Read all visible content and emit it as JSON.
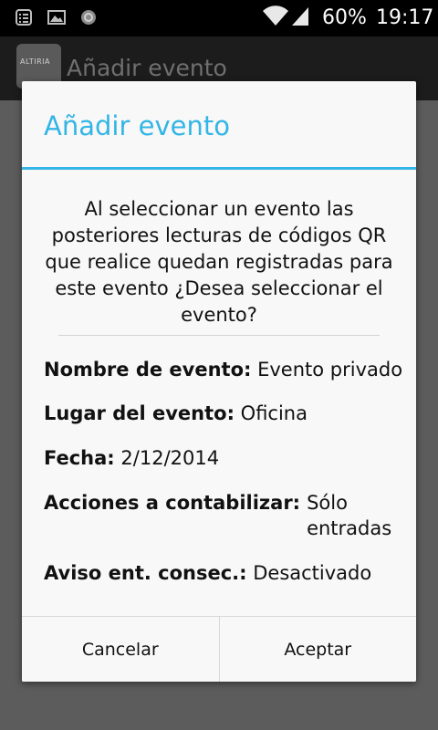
{
  "status_bar": {
    "battery_pct": "60%",
    "time": "19:17",
    "icons": [
      "notification-list-icon",
      "image-icon",
      "sync-icon",
      "wifi-icon",
      "signal-icon"
    ]
  },
  "app_bar": {
    "logo_text": "ALTIRIA",
    "title": "Añadir evento"
  },
  "dialog": {
    "title": "Añadir evento",
    "message": "Al seleccionar un evento las posteriores lecturas de códigos QR que realice quedan registradas para este evento ¿Desea seleccionar el evento?",
    "details": {
      "event_name": {
        "label": "Nombre de evento:",
        "value": "Evento privado"
      },
      "location": {
        "label": "Lugar del evento:",
        "value": "Oficina"
      },
      "date": {
        "label": "Fecha:",
        "value": "2/12/2014"
      },
      "actions": {
        "label": "Acciones a contabilizar:",
        "value": "Sólo entradas"
      },
      "notice": {
        "label": "Aviso ent. consec.:",
        "value": "Desactivado"
      }
    },
    "buttons": {
      "cancel": "Cancelar",
      "accept": "Aceptar"
    },
    "accent_color": "#33b5e5"
  }
}
